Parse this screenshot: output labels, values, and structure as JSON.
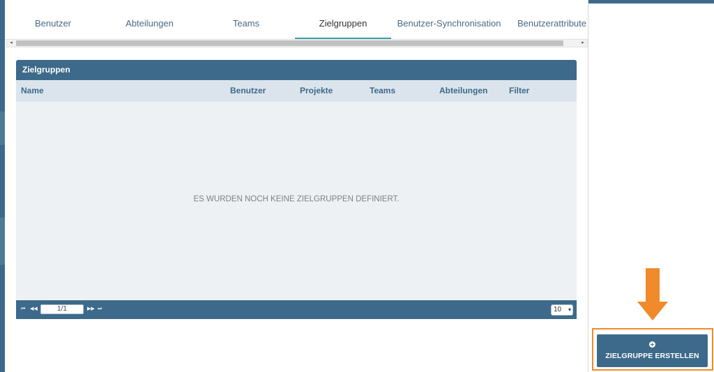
{
  "tabs": [
    {
      "label": "Benutzer"
    },
    {
      "label": "Abteilungen"
    },
    {
      "label": "Teams"
    },
    {
      "label": "Zielgruppen",
      "active": true
    },
    {
      "label": "Benutzer-Synchronisation"
    },
    {
      "label": "Benutzerattribute"
    }
  ],
  "scrollbar": {
    "left_arrow": "◂",
    "right_arrow": "▸"
  },
  "table": {
    "title": "Zielgruppen",
    "columns": [
      "Name",
      "Benutzer",
      "Projekte",
      "Teams",
      "Abteilungen",
      "Filter"
    ],
    "empty_message": "ES WURDEN NOCH KEINE ZIELGRUPPEN DEFINIERT."
  },
  "pager": {
    "first": "⏮",
    "prev": "◀◀",
    "next": "▶▶",
    "last": "⏭",
    "page_value": "1/1",
    "page_size": "10"
  },
  "create_button": {
    "label": "ZIELGRUPPE ERSTELLEN"
  },
  "colors": {
    "primary": "#3d6a8a",
    "highlight": "#f08a2b",
    "active_tab_underline": "#3aa0a6"
  },
  "icons": {
    "create": "plus-circle-icon",
    "annotation": "arrow-down-icon"
  }
}
